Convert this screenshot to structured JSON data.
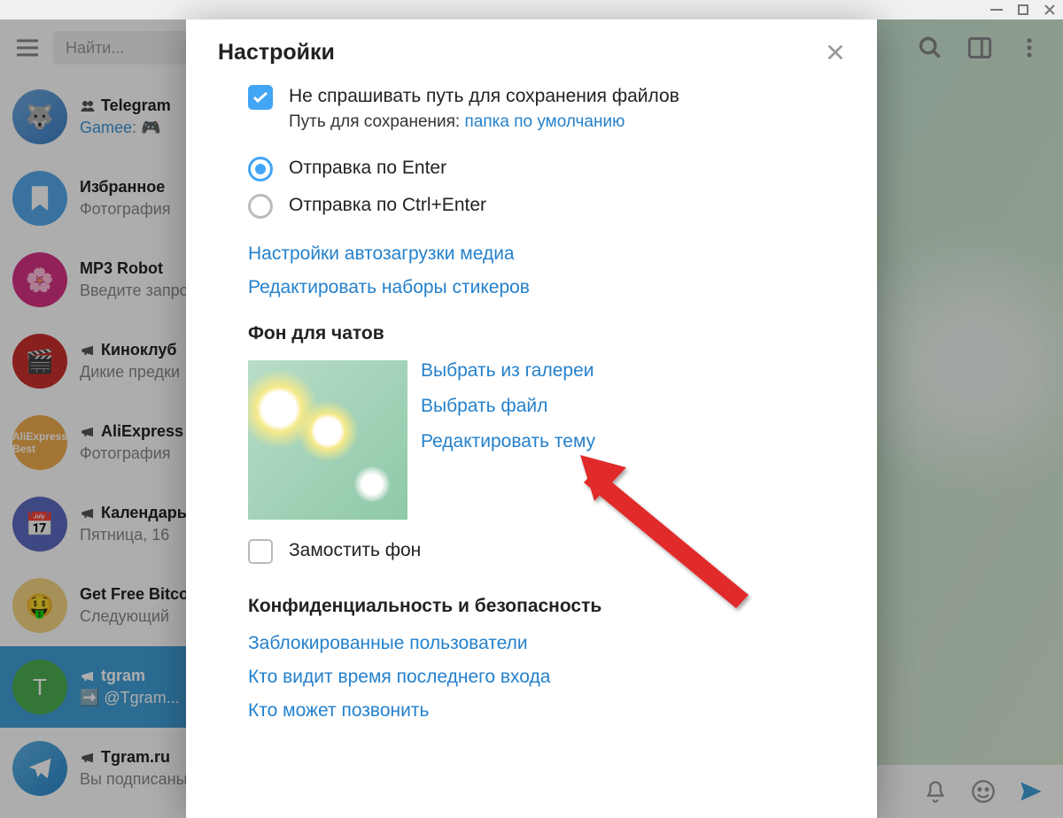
{
  "titlebar": {
    "min": "—",
    "max": "▢",
    "close": "✕"
  },
  "search": {
    "placeholder": "Найти..."
  },
  "chats": [
    {
      "title": "Telegram",
      "sender": "Gamee",
      "sub": ": 🎮"
    },
    {
      "title": "Избранное",
      "sub": "Фотография"
    },
    {
      "title": "MP3 Robot",
      "sub": "Введите запрос"
    },
    {
      "title": "Киноклуб",
      "sub": "Дикие предки"
    },
    {
      "title": "AliExpress",
      "sub": "Фотография"
    },
    {
      "title": "Календарь",
      "sub": "Пятница, 16"
    },
    {
      "title": "Get Free Bitcoin",
      "sub": "Следующий"
    },
    {
      "title": "tgram",
      "sub": "➡️ @Tgram..."
    },
    {
      "title": "Tgram.ru",
      "sub": "Вы подписаны"
    }
  ],
  "modal": {
    "title": "Настройки",
    "dontAskPath": "Не спрашивать путь для сохранения файлов",
    "savePathLabel": "Путь для сохранения: ",
    "savePathLink": "папка по умолчанию",
    "sendEnter": "Отправка по Enter",
    "sendCtrlEnter": "Отправка по Ctrl+Enter",
    "mediaAutoload": "Настройки автозагрузки медиа",
    "editStickers": "Редактировать наборы стикеров",
    "chatBgTitle": "Фон для чатов",
    "chooseGallery": "Выбрать из галереи",
    "chooseFile": "Выбрать файл",
    "editTheme": "Редактировать тему",
    "tileBg": "Замостить фон",
    "privacyTitle": "Конфиденциальность и безопасность",
    "blockedUsers": "Заблокированные пользователи",
    "lastSeen": "Кто видит время последнего входа",
    "whoCalls": "Кто может позвонить"
  }
}
